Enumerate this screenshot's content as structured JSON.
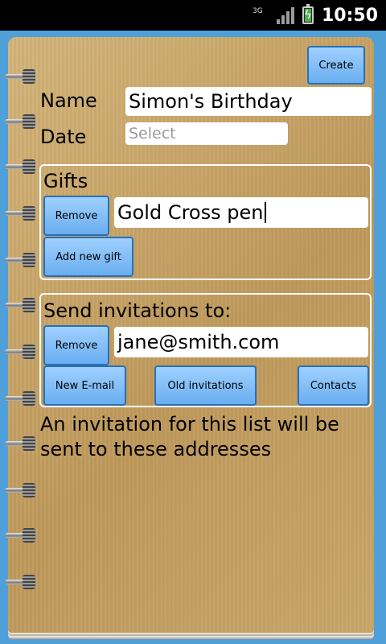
{
  "status_bar": {
    "network": "3G",
    "time": "10:50",
    "icons": [
      "network-3g-icon",
      "signal-icon",
      "battery-charging-icon"
    ]
  },
  "form": {
    "create_label": "Create",
    "name_label": "Name",
    "name_value": "Simon's Birthday",
    "date_label": "Date",
    "date_placeholder": "Select"
  },
  "gifts": {
    "title": "Gifts",
    "remove_label": "Remove",
    "gift_value": "Gold Cross pen",
    "add_label": "Add new gift"
  },
  "invitations": {
    "title": "Send invitations to:",
    "remove_label": "Remove",
    "email_value": "jane@smith.com",
    "new_email_label": "New E-mail",
    "old_invitations_label": "Old invitations",
    "contacts_label": "Contacts"
  },
  "note": {
    "line1": "An invitation for this list will be",
    "line2": "sent to these addresses"
  },
  "colors": {
    "background": "#4fa0d8",
    "paper": "#c8a769",
    "button": "#6aaef0",
    "button_border": "#2b6fb4"
  }
}
